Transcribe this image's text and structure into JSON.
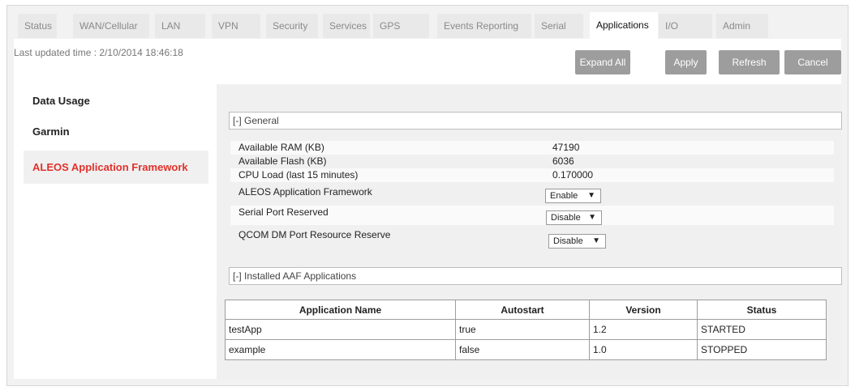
{
  "tabs": [
    {
      "label": "Status"
    },
    {
      "label": "WAN/Cellular"
    },
    {
      "label": "LAN"
    },
    {
      "label": "VPN"
    },
    {
      "label": "Security"
    },
    {
      "label": "Services"
    },
    {
      "label": "GPS"
    },
    {
      "label": "Events Reporting"
    },
    {
      "label": "Serial"
    },
    {
      "label": "Applications"
    },
    {
      "label": "I/O"
    },
    {
      "label": "Admin"
    }
  ],
  "active_tab": "Applications",
  "last_updated": "Last updated time : 2/10/2014 18:46:18",
  "toolbar": {
    "expand_all": "Expand All",
    "apply": "Apply",
    "refresh": "Refresh",
    "cancel": "Cancel"
  },
  "sidebar": {
    "items": [
      {
        "label": "Data Usage"
      },
      {
        "label": "Garmin"
      },
      {
        "label": "ALEOS Application Framework"
      }
    ],
    "active": "ALEOS Application Framework"
  },
  "general": {
    "title": "[-] General",
    "rows": [
      {
        "label": "Available RAM (KB)",
        "value": "47190"
      },
      {
        "label": "Available Flash (KB)",
        "value": "6036"
      },
      {
        "label": "CPU Load (last 15 minutes)",
        "value": "0.170000"
      },
      {
        "label": "ALEOS Application Framework",
        "value": "Enable"
      },
      {
        "label": "Serial Port Reserved",
        "value": "Disable"
      },
      {
        "label": "QCOM DM Port Resource Reserve",
        "value": "Disable"
      }
    ]
  },
  "installed": {
    "title": "[-] Installed AAF Applications",
    "columns": [
      "Application Name",
      "Autostart",
      "Version",
      "Status"
    ],
    "rows": [
      [
        "testApp",
        "true",
        "1.2",
        "STARTED"
      ],
      [
        "example",
        "false",
        "1.0",
        "STOPPED"
      ]
    ]
  },
  "colors": {
    "accent_red": "#e0312b",
    "button_gray": "#9d9d9d",
    "panel_bg": "#f0f0f0"
  }
}
